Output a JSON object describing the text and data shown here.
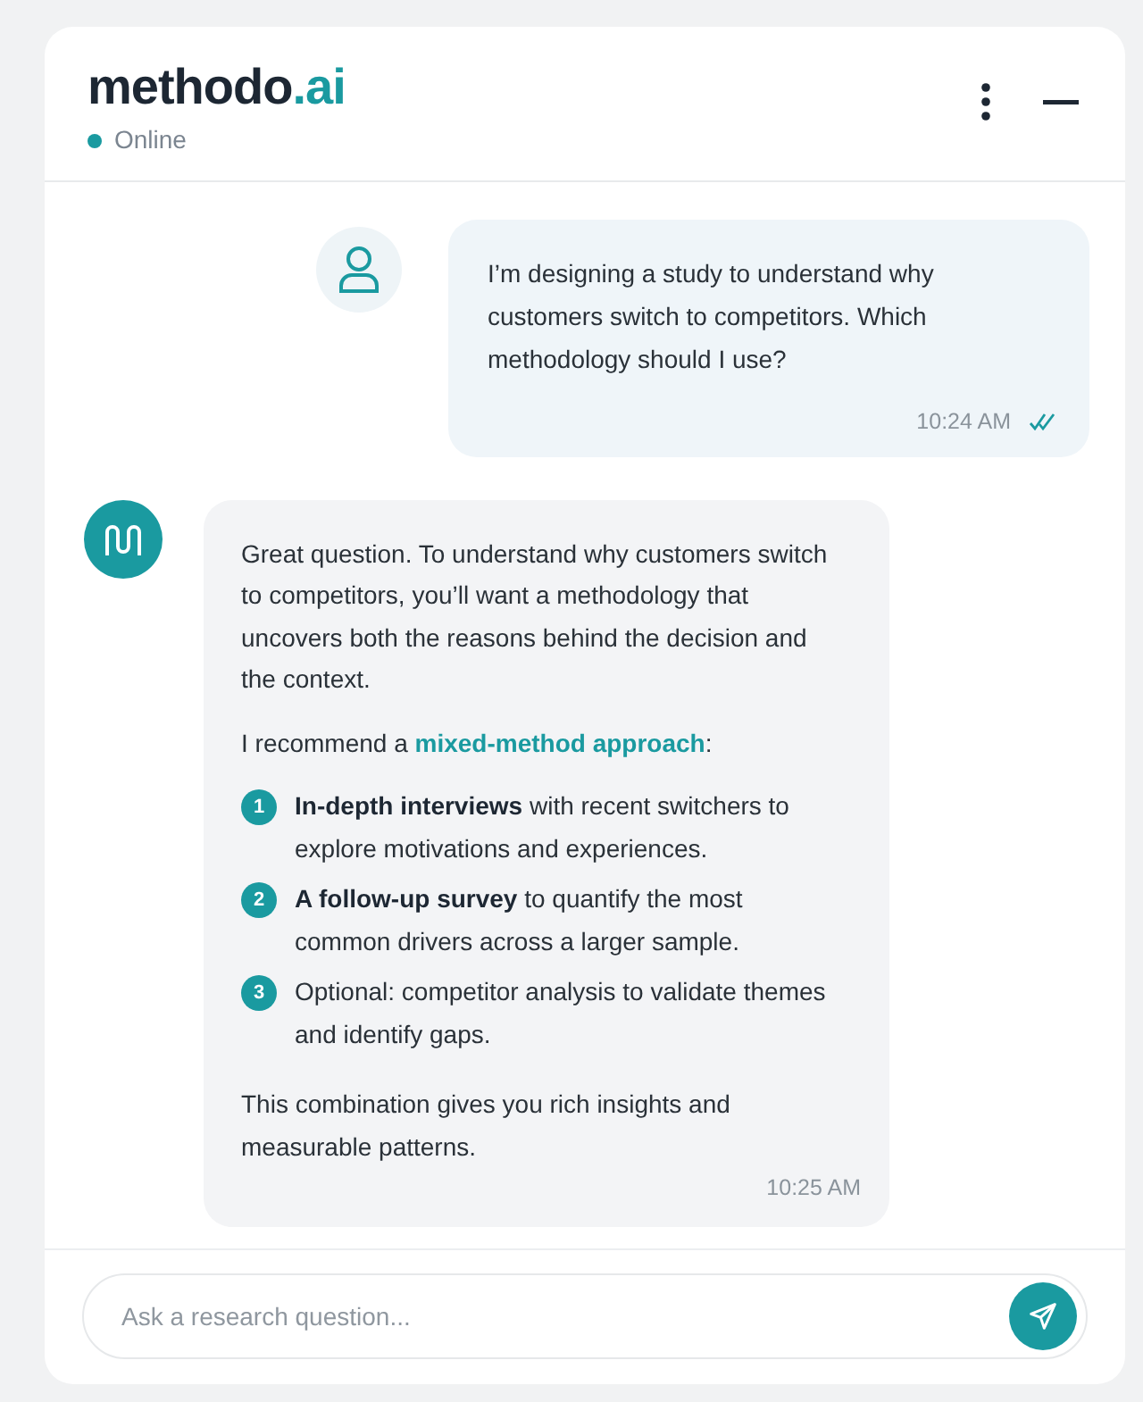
{
  "header": {
    "brand": "methodo",
    "brand_suffix": ".ai",
    "status": {
      "label": "Online",
      "color": "#1a9aa0"
    }
  },
  "messages": [
    {
      "kind": "user",
      "paragraphs": [
        "I’m designing a study to understand why customers switch to competitors. Which methodology should I use?"
      ],
      "time": "10:24 AM",
      "read": true
    },
    {
      "kind": "bot",
      "paragraphs": [
        "Great question. To understand why customers switch to competitors, you’ll want a methodology that uncovers both the reasons behind the decision and the context.",
        "I recommend a **mixed-method approach**:"
      ],
      "steps": [
        {
          "number": "1",
          "text": "**In-depth interviews** with recent switchers to explore motivations and experiences."
        },
        {
          "number": "2",
          "text": "**A follow-up survey** to quantify the most common drivers across a larger sample."
        },
        {
          "number": "3",
          "text": "Optional: competitor analysis to validate themes and identify gaps."
        }
      ],
      "closing": "This combination gives you rich insights and measurable patterns.",
      "time": "10:25 AM",
      "read": false
    }
  ],
  "composer": {
    "placeholder": "Ask a research question..."
  }
}
